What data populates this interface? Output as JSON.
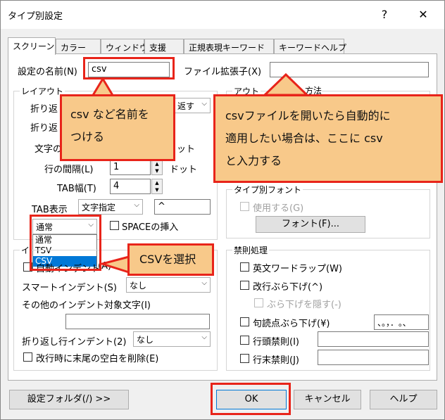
{
  "window": {
    "title": "タイプ別設定",
    "help_glyph": "?",
    "close_glyph": "✕"
  },
  "tabs": [
    {
      "label": "スクリーン"
    },
    {
      "label": "カラー"
    },
    {
      "label": "ウィンドウ"
    },
    {
      "label": "支援"
    },
    {
      "label": "正規表現キーワード"
    },
    {
      "label": "キーワードヘルプ"
    }
  ],
  "screen": {
    "name_label": "設定の名前(N)",
    "name_value": "csv",
    "ext_label": "ファイル拡張子(X)",
    "ext_value": "",
    "layout": {
      "title": "レイアウト",
      "wrap_label": "折り返",
      "wrap_combo": "返す",
      "wrap2_label": "折り返",
      "char_label": "文字の",
      "dot1": "ット",
      "line_spacing_label": "行の間隔(L)",
      "line_spacing_value": "1",
      "dot2": "ドット",
      "tab_width_label": "TAB幅(T)",
      "tab_width_value": "4",
      "tab_display_label": "TAB表示",
      "tab_display_combo": "文字指定",
      "tab_char_value": "^",
      "layout_combo": "通常",
      "space_insert_label": "SPACEの挿入",
      "dropdown_options": [
        "通常",
        "TSV",
        "CSV"
      ]
    },
    "outline": {
      "title_a": "アウト",
      "title_b": "方法"
    },
    "type_font": {
      "title": "タイプ別フォント",
      "use_label": "使用する(G)",
      "font_button": "フォント(F)..."
    },
    "indent": {
      "title": "イ",
      "auto_indent_label": "自動インデント",
      "auto_indent_suffix": "(A)",
      "smart_indent_label": "スマートインデント(S)",
      "smart_indent_value": "なし",
      "other_chars_label": "その他のインデント対象文字(I)",
      "other_chars_value": "",
      "wrap_indent_label": "折り返し行インデント(2)",
      "wrap_indent_value": "なし",
      "trim_label": "改行時に末尾の空白を削除(E)"
    },
    "kinsoku": {
      "title": "禁則処理",
      "english_wrap": "英文ワードラップ(W)",
      "newline_hang": "改行ぶら下げ(^)",
      "hide_hang": "ぶら下げを隠す(-)",
      "punct_hang": "句読点ぶら下げ(¥)",
      "punct_value": "、。，．｡､",
      "head_kinsoku": "行頭禁則(I)",
      "tail_kinsoku": "行末禁則(J)"
    }
  },
  "buttons": {
    "settings_folder": "設定フォルダ(/) >>",
    "ok": "OK",
    "cancel": "キャンセル",
    "help": "ヘルプ"
  },
  "annotations": {
    "callout1_line1": "csv など名前を",
    "callout1_line2": "つける",
    "callout2_line1": "csvファイルを開いたら自動的に",
    "callout2_line2": "適用したい場合は、ここに csv",
    "callout2_line3": "と入力する",
    "callout3": "CSVを選択"
  },
  "colors": {
    "annotation_red": "#e8241a",
    "callout_fill": "#f8c98a",
    "selection_blue": "#0078d7"
  }
}
